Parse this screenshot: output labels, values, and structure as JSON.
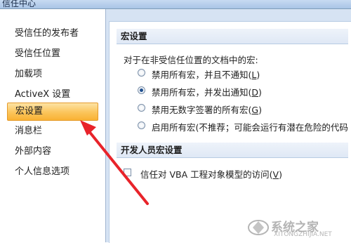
{
  "window": {
    "title": "信任中心"
  },
  "sidebar": {
    "items": [
      {
        "label": "受信任的发布者",
        "active": false
      },
      {
        "label": "受信任位置",
        "active": false
      },
      {
        "label": "加载项",
        "active": false
      },
      {
        "label": "ActiveX 设置",
        "active": false
      },
      {
        "label": "宏设置",
        "active": true
      },
      {
        "label": "消息栏",
        "active": false
      },
      {
        "label": "外部内容",
        "active": false
      },
      {
        "label": "个人信息选项",
        "active": false
      }
    ]
  },
  "macro_settings": {
    "header": "宏设置",
    "prompt": "对于在非受信任位置的文档中的宏:",
    "options": [
      {
        "label": "禁用所有宏，并且不通知",
        "key": "L",
        "selected": false
      },
      {
        "label": "禁用所有宏，并发出通知",
        "key": "D",
        "selected": true
      },
      {
        "label": "禁用无数字签署的所有宏",
        "key": "G",
        "selected": false
      },
      {
        "label": "启用所有宏(不推荐；可能会运行有潜在危险的代码",
        "key": "",
        "selected": false
      }
    ]
  },
  "developer_settings": {
    "header": "开发人员宏设置",
    "checkbox_label": "信任对 VBA 工程对象模型的访问",
    "checkbox_key": "V",
    "checked": false
  },
  "watermark": {
    "text": "系统之家",
    "url": "XITONGZHIJIA.NET"
  },
  "colors": {
    "active_item": "#fbc45a",
    "arrow": "#e8232a",
    "panel_bg": "#d6e3f3"
  }
}
